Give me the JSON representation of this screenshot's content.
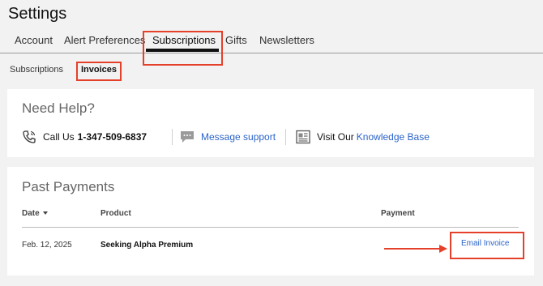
{
  "page": {
    "title": "Settings"
  },
  "tabs": [
    {
      "label": "Account"
    },
    {
      "label": "Alert Preferences"
    },
    {
      "label": "Subscriptions"
    },
    {
      "label": "Gifts"
    },
    {
      "label": "Newsletters"
    }
  ],
  "subtabs": [
    {
      "label": "Subscriptions"
    },
    {
      "label": "Invoices"
    }
  ],
  "help": {
    "title": "Need Help?",
    "call_label": "Call Us",
    "phone": "1-347-509-6837",
    "message_link": "Message support",
    "visit_label": "Visit Our",
    "kb_link": "Knowledge Base"
  },
  "payments": {
    "title": "Past Payments",
    "columns": {
      "date": "Date",
      "product": "Product",
      "payment": "Payment"
    },
    "rows": [
      {
        "date": "Feb. 12, 2025",
        "product": "Seeking Alpha Premium",
        "action": "Email Invoice"
      }
    ]
  },
  "colors": {
    "accent_link": "#2b63c9",
    "annotation_red": "#e5402a",
    "background": "#f2f2f2"
  }
}
